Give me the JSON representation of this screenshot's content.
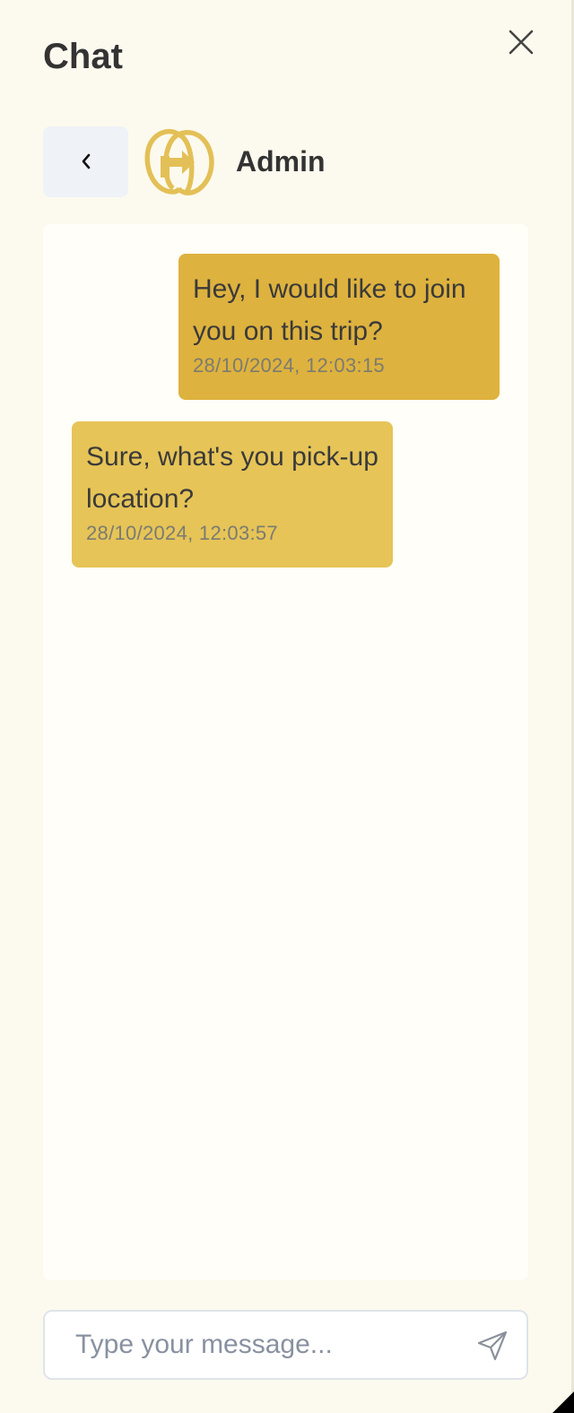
{
  "header": {
    "title": "Chat"
  },
  "contact": {
    "name": "Admin"
  },
  "messages": [
    {
      "direction": "sent",
      "text": "Hey, I would like to join you on this trip?",
      "timestamp": "28/10/2024, 12:03:15"
    },
    {
      "direction": "received",
      "text": "Sure, what's you pick-up location?",
      "timestamp": "28/10/2024, 12:03:57"
    }
  ],
  "composer": {
    "value": "",
    "placeholder": "Type your message..."
  },
  "icons": {
    "close": "close-icon",
    "back": "chevron-left-icon",
    "avatar": "go-logo-icon",
    "send": "send-icon"
  },
  "colors": {
    "panel_background": "#fcfaee",
    "sent_bubble": "#deb23e",
    "received_bubble": "#e6c457",
    "logo": "#e3c057"
  }
}
